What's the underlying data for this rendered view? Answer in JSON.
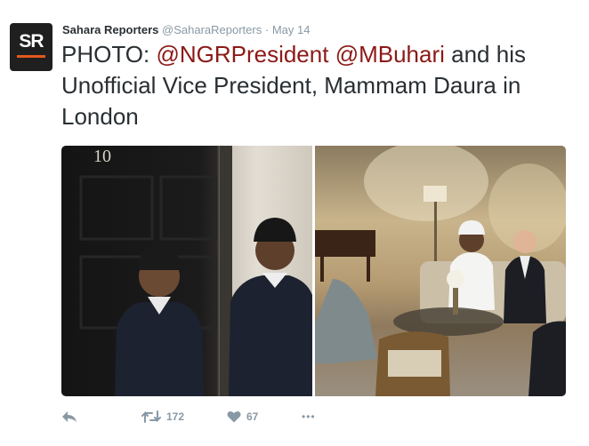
{
  "account": {
    "avatar_text": "SR",
    "name": "Sahara Reporters",
    "handle": "@SaharaReporters",
    "separator": "·",
    "date": "May 14"
  },
  "tweet": {
    "part1": "PHOTO: ",
    "mention1": "@NGRPresident",
    "space": " ",
    "mention2": "@MBuhari",
    "part2": " and his Unofficial Vice President, Mammam Daura in London"
  },
  "media": {
    "door_number": "10"
  },
  "actions": {
    "retweet_count": "172",
    "like_count": "67",
    "more_label": "•••"
  },
  "colors": {
    "mention": "#8b1a17",
    "meta": "#8899a6",
    "text": "#292f33",
    "brand_orange": "#e2581c"
  }
}
